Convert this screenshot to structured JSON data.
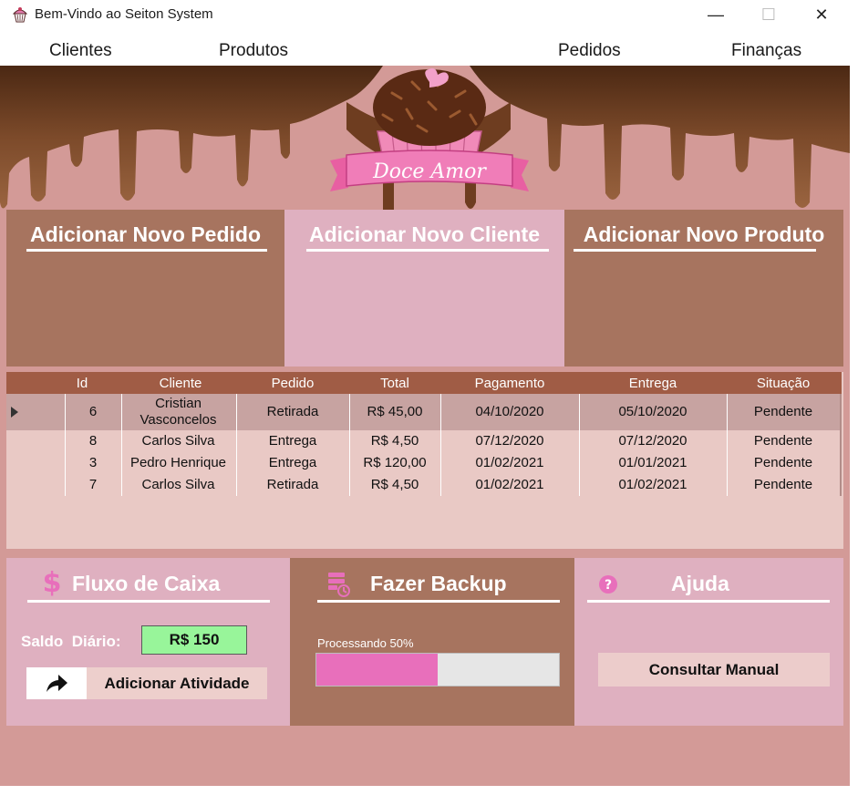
{
  "window": {
    "title": "Bem-Vindo ao Seiton System",
    "controls": {
      "minimize": "—",
      "maximize": "☐",
      "close": "✕"
    }
  },
  "menu": {
    "items": [
      "Clientes",
      "Produtos",
      "Pedidos",
      "Finanças"
    ]
  },
  "banner": {
    "logo_text": "Doce Amor"
  },
  "actions": {
    "novo_pedido": "Adicionar Novo Pedido",
    "novo_cliente": "Adicionar Novo Cliente",
    "novo_produto": "Adicionar Novo Produto"
  },
  "orders": {
    "columns": [
      "Id",
      "Cliente",
      "Pedido",
      "Total",
      "Pagamento",
      "Entrega",
      "Situação"
    ],
    "rows": [
      {
        "id": "6",
        "cliente": "Cristian Vasconcelos",
        "pedido": "Retirada",
        "total": "R$ 45,00",
        "pagamento": "04/10/2020",
        "entrega": "05/10/2020",
        "situacao": "Pendente"
      },
      {
        "id": "8",
        "cliente": "Carlos Silva",
        "pedido": "Entrega",
        "total": "R$ 4,50",
        "pagamento": "07/12/2020",
        "entrega": "07/12/2020",
        "situacao": "Pendente"
      },
      {
        "id": "3",
        "cliente": "Pedro Henrique",
        "pedido": "Entrega",
        "total": "R$ 120,00",
        "pagamento": "01/02/2021",
        "entrega": "01/01/2021",
        "situacao": "Pendente"
      },
      {
        "id": "7",
        "cliente": "Carlos Silva",
        "pedido": "Retirada",
        "total": "R$ 4,50",
        "pagamento": "01/02/2021",
        "entrega": "01/02/2021",
        "situacao": "Pendente"
      }
    ]
  },
  "caixa": {
    "title": "Fluxo de Caixa",
    "saldo_label": "Saldo  Diário:",
    "saldo_value": "R$ 150",
    "atividade_button": "Adicionar Atividade"
  },
  "backup": {
    "title": "Fazer Backup",
    "status": "Processando 50%",
    "progress": 0.5
  },
  "ajuda": {
    "title": "Ajuda",
    "manual_button": "Consultar Manual"
  },
  "colors": {
    "background": "#d39a97",
    "panel_brown": "#a7745f",
    "panel_pink": "#dfb0c0",
    "grid_header": "#a05c45",
    "grid_body": "#e9c9c5",
    "selected_row": "#c7a3a1",
    "accent_pink": "#e86fbb",
    "saldo_green": "#98f59a"
  }
}
